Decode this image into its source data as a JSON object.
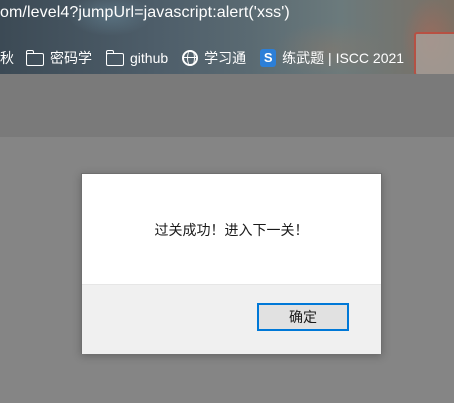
{
  "browser": {
    "address_text": "om/level4?jumpUrl=javascript:alert('xss')",
    "bookmarks": [
      {
        "label": "秋",
        "icon": "none"
      },
      {
        "label": "密码学",
        "icon": "folder-icon"
      },
      {
        "label": "github",
        "icon": "folder-icon"
      },
      {
        "label": "学习通",
        "icon": "globe-icon"
      },
      {
        "label": "练武题 | ISCC 2021",
        "icon": "site-icon"
      }
    ],
    "site_icon_glyph": "S"
  },
  "dialog": {
    "message": "过关成功！进入下一关！",
    "ok_label": "确定"
  },
  "colors": {
    "overlay_gray": "#858585",
    "button_focus_border": "#0078d7"
  }
}
